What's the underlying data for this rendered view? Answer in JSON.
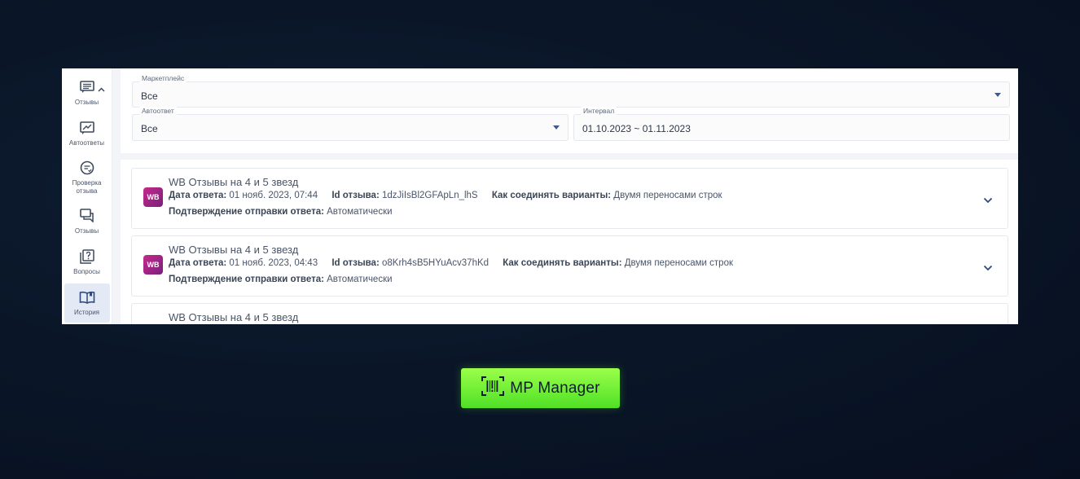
{
  "sidebar": {
    "items": [
      {
        "label": "Отзывы",
        "icon": "message-square-icon",
        "active": false
      },
      {
        "label": "Автоответы",
        "icon": "edit-chart-icon",
        "active": false
      },
      {
        "label": "Проверка отзыва",
        "icon": "chat-check-icon",
        "active": false
      },
      {
        "label": "Отзывы",
        "icon": "chat-bubbles-icon",
        "active": false
      },
      {
        "label": "Вопросы",
        "icon": "question-square-icon",
        "active": false
      },
      {
        "label": "История",
        "icon": "book-open-icon",
        "active": true
      }
    ]
  },
  "filters": {
    "marketplace": {
      "label": "Маркетплейс",
      "value": "Все"
    },
    "autoreply": {
      "label": "Автоответ",
      "value": "Все"
    },
    "interval": {
      "label": "Интервал",
      "value": "01.10.2023 ~ 01.11.2023"
    }
  },
  "history": {
    "items": [
      {
        "logo": "WB",
        "title": "WB Отзывы на 4 и 5 звезд",
        "date_label": "Дата ответа:",
        "date_value": "01 нояб. 2023, 07:44",
        "id_label": "Id отзыва:",
        "id_value": "1dzJiIsBl2GFApLn_lhS",
        "join_label": "Как соединять варианты:",
        "join_value": "Двумя переносами строк",
        "confirm_label": "Подтверждение отправки ответа:",
        "confirm_value": "Автоматически"
      },
      {
        "logo": "WB",
        "title": "WB Отзывы на 4 и 5 звезд",
        "date_label": "Дата ответа:",
        "date_value": "01 нояб. 2023, 04:43",
        "id_label": "Id отзыва:",
        "id_value": "o8Krh4sB5HYuAcv37hKd",
        "join_label": "Как соединять варианты:",
        "join_value": "Двумя переносами строк",
        "confirm_label": "Подтверждение отправки ответа:",
        "confirm_value": "Автоматически"
      },
      {
        "title": "WB Отзывы на 4 и 5 звезд"
      }
    ]
  },
  "brand": {
    "name": "MP Manager",
    "color": "#7cf23a"
  }
}
